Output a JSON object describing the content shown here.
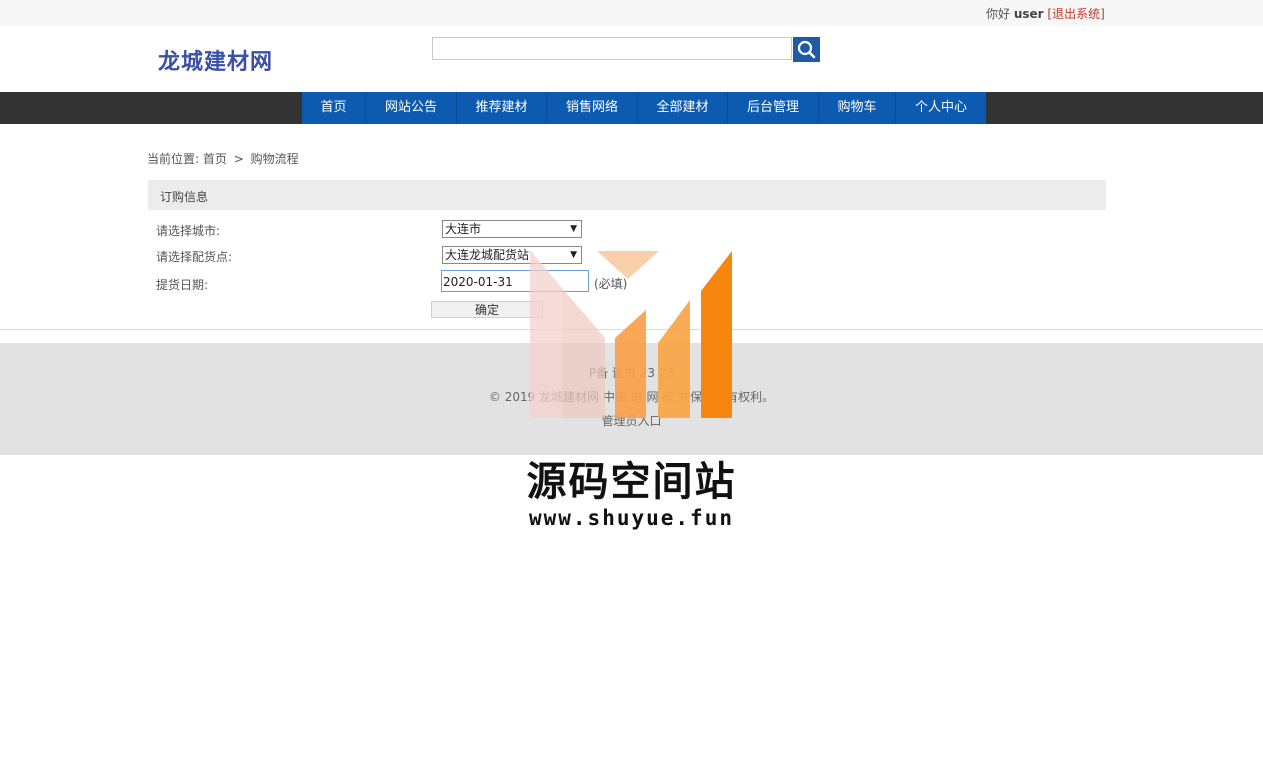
{
  "topbar": {
    "greeting": "你好",
    "username": "user",
    "logout": "[退出系统]"
  },
  "site": {
    "logo": "龙城建材网"
  },
  "search": {
    "value": "",
    "icon": "search-icon"
  },
  "nav": {
    "items": [
      "首页",
      "网站公告",
      "推荐建材",
      "销售网络",
      "全部建材",
      "后台管理",
      "购物车",
      "个人中心"
    ]
  },
  "breadcrumb": {
    "prefix": "当前位置:",
    "home": "首页",
    "separator": ">",
    "current": "购物流程"
  },
  "order": {
    "section_title": "订购信息",
    "city_label": "请选择城市:",
    "city_value": "大连市",
    "station_label": "请选择配货点:",
    "station_value": "大连龙城配货站",
    "date_label": "提货日期:",
    "date_value": "2020-01-31",
    "required_note": "(必填)",
    "confirm_label": "确定"
  },
  "footer": {
    "icp": "P备 证书 23 23",
    "copyright": "© 2019 龙城建材网 中国 的 网 权 并保留所有权利。",
    "admin_link": "管理员入口"
  },
  "watermark": {
    "title": "源码空间站",
    "url": "www.shuyue.fun"
  },
  "colors": {
    "nav_blue": "#0d5bb0",
    "nav_bar": "#333333",
    "logo": "#3a4fa8",
    "logout": "#c0392b",
    "search_button": "#1f5aa8"
  }
}
